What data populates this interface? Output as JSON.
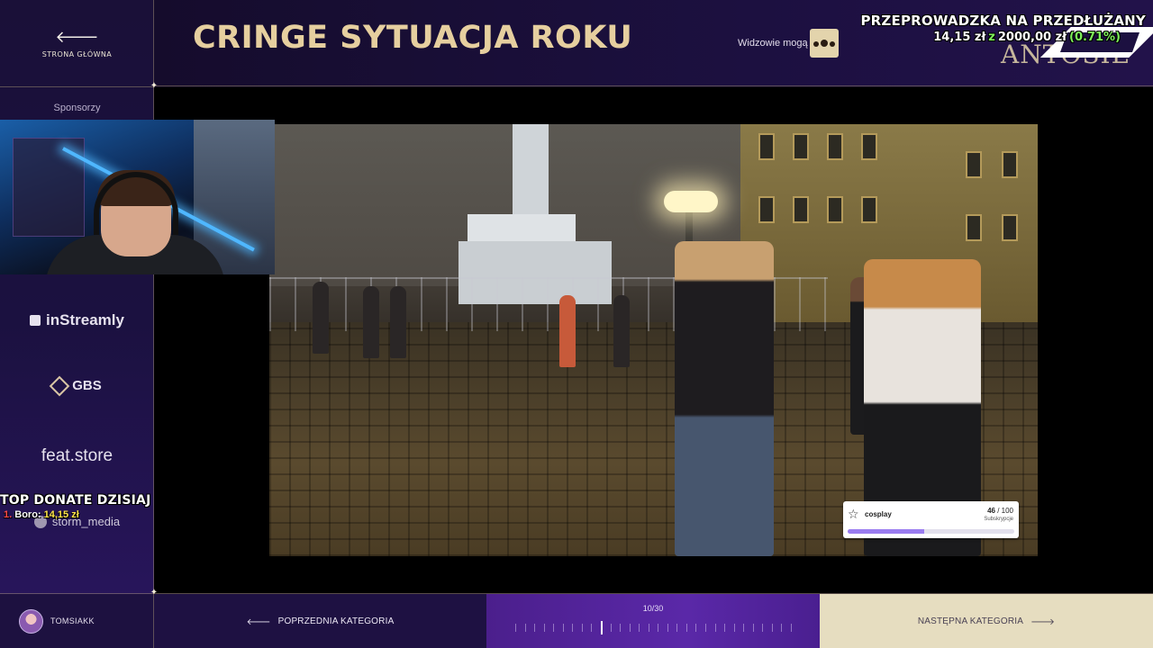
{
  "sidebar": {
    "home_label": "STRONA GŁÓWNA",
    "home_icon": "arrow-left-icon",
    "sponsors_title": "Sponsorzy",
    "sponsors": [
      "inStreamly",
      "GBS",
      "feat.store",
      "storm_media"
    ]
  },
  "top_donate": {
    "title": "TOP DONATE DZISIAJ",
    "rank": "1.",
    "name": "Boro:",
    "amount": "14,15 zł"
  },
  "header": {
    "title": "CRINGE SYTUACJA ROKU",
    "viewers_label": "Widzowie mogą",
    "viewers_icon": "users-icon"
  },
  "goal": {
    "title": "PRZEPROWADZKA NA PRZEDŁUŻANY",
    "current": "14,15 zł",
    "separator": "z",
    "target": "2000,00 zł",
    "percent": "(0.71%)",
    "background_text": "ANTOSIE"
  },
  "sub_goal": {
    "name": "cosplay",
    "current": "46",
    "total": "/ 100",
    "kind": "Subskrypcje",
    "progress": 0.46,
    "accent": "#9a7cf0"
  },
  "footer": {
    "username": "TOMSIAKK",
    "prev_label": "POPRZEDNIA KATEGORIA",
    "next_label": "NASTĘPNA KATEGORIA",
    "progress_text": "10/30",
    "current_index": 10,
    "total": 30
  },
  "colors": {
    "title_gold": "#e6cf9f",
    "sidebar_bg": "#1b1140",
    "progress_purple": "#5a28a8",
    "next_cream": "#e6ddc0",
    "green_accent": "#7df05a",
    "yellow_accent": "#ffe54a"
  }
}
